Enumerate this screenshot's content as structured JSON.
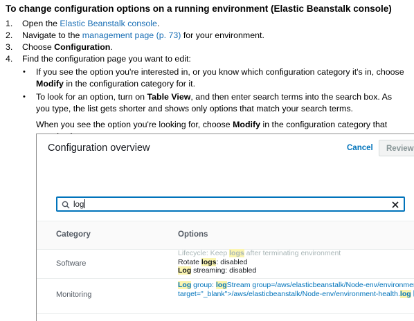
{
  "heading": "To change configuration options on a running environment (Elastic Beanstalk console)",
  "steps": [
    {
      "num": "1.",
      "pre": "Open the ",
      "link": "Elastic Beanstalk console",
      "post": "."
    },
    {
      "num": "2.",
      "pre": "Navigate to the ",
      "link": "management page (p. 73)",
      "post": " for your environment."
    },
    {
      "num": "3.",
      "pre": "Choose ",
      "bold": "Configuration",
      "post": "."
    },
    {
      "num": "4.",
      "text": "Find the configuration page you want to edit:"
    }
  ],
  "bullets": [
    {
      "pre": "If you see the option you're interested in, or you know which configuration category it's in, choose ",
      "bold": "Modify",
      "post": " in the configuration category for it."
    },
    {
      "pre": "To look for an option, turn on ",
      "bold": "Table View",
      "post": ", and then enter search terms into the search box. As you type, the list gets shorter and shows only options that match your search terms."
    }
  ],
  "after": {
    "pre": "When you see the option you're looking for, choose ",
    "bold": "Modify",
    "post": " in the configuration category that contains it."
  },
  "screenshot": {
    "title": "Configuration overview",
    "cancel": "Cancel",
    "review": "Review c",
    "search_value": "log",
    "headers": {
      "category": "Category",
      "options": "Options"
    },
    "rows": [
      {
        "category": "Software",
        "lines": [
          {
            "muted": true,
            "parts": [
              {
                "t": "Lifecycle: Keep "
              },
              {
                "t": "logs",
                "hl": true
              },
              {
                "t": " after terminating environment"
              }
            ]
          },
          {
            "parts": [
              {
                "t": "Rotate "
              },
              {
                "t": "logs",
                "hl": true
              },
              {
                "t": ": disabled"
              }
            ]
          },
          {
            "parts": [
              {
                "t": "Log",
                "hl": true
              },
              {
                "t": " streaming: disabled"
              }
            ]
          }
        ]
      },
      {
        "category": "Monitoring",
        "lines": [
          {
            "blue": true,
            "parts": [
              {
                "t": "Log",
                "hl": true
              },
              {
                "t": " group: "
              },
              {
                "t": "log",
                "hl": true
              },
              {
                "t": "Stream group=/aws/elasticbeanstalk/Node-env/environment-hea"
              }
            ]
          },
          {
            "blue": true,
            "ext": true,
            "parts": [
              {
                "t": "target=\"_blank\">/aws/elasticbeanstalk/Node-env/environment-health."
              },
              {
                "t": "log",
                "hl": true
              }
            ]
          }
        ]
      }
    ]
  }
}
